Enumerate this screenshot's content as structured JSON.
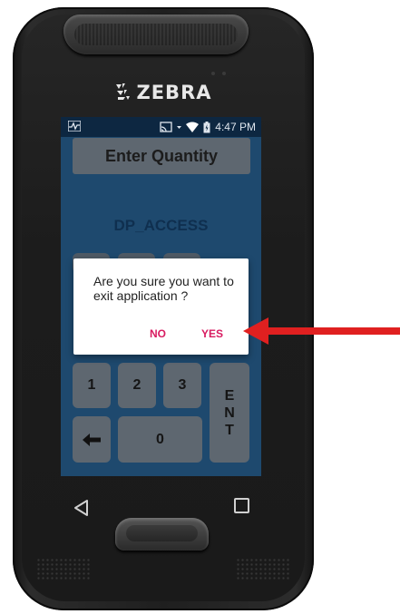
{
  "device": {
    "brand": "ZEBRA"
  },
  "status_bar": {
    "time": "4:47 PM"
  },
  "app": {
    "title_button": "Enter Quantity",
    "subtitle": "DP_ACCESS",
    "keypad": {
      "k1": "1",
      "k2": "2",
      "k3": "3",
      "k0": "0",
      "ent_e": "E",
      "ent_n": "N",
      "ent_t": "T"
    }
  },
  "dialog": {
    "message": "Are you sure you want to exit application ?",
    "no_label": "NO",
    "yes_label": "YES"
  },
  "colors": {
    "screen_bg": "#1e496e",
    "status_bg": "#0d2741",
    "key_bg": "#5e6770",
    "dialog_button": "#d81b60",
    "arrow": "#e02020"
  }
}
